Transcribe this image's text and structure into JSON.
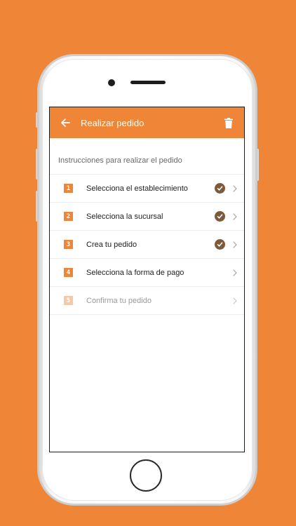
{
  "appbar": {
    "title": "Realizar pedido",
    "back_icon": "arrow-left-icon",
    "delete_icon": "trash-icon"
  },
  "instructions": "Instrucciones para realizar el pedido",
  "steps": [
    {
      "number": "1",
      "label": "Selecciona el establecimiento",
      "completed": true,
      "enabled": true
    },
    {
      "number": "2",
      "label": "Selecciona la sucursal",
      "completed": true,
      "enabled": true
    },
    {
      "number": "3",
      "label": "Crea tu pedido",
      "completed": true,
      "enabled": true
    },
    {
      "number": "4",
      "label": "Selecciona la forma de pago",
      "completed": false,
      "enabled": true
    },
    {
      "number": "5",
      "label": "Confirma tu pedido",
      "completed": false,
      "enabled": false
    }
  ],
  "colors": {
    "background": "#EF8537",
    "accent": "#EF8537",
    "accent_disabled": "#F5C9A7",
    "check": "#7B5B3B"
  }
}
